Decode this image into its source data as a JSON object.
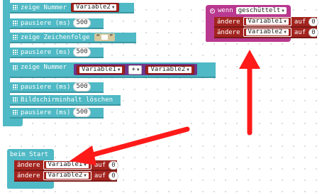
{
  "blocks": {
    "show_number_1": {
      "label": "zeige Nummer",
      "variable": "Variable2"
    },
    "pause_1": {
      "label": "pausiere (ms)",
      "value": "500"
    },
    "show_string": {
      "label": "zeige Zeichenfolge",
      "quote_open": "“",
      "quote_close": "”"
    },
    "pause_2": {
      "label": "pausiere (ms)",
      "value": "500"
    },
    "show_number_2": {
      "label": "zeige Nummer",
      "var_left": "Variable1",
      "operator": "+",
      "var_right": "Variable2"
    },
    "pause_3": {
      "label": "pausiere (ms)",
      "value": "500"
    },
    "clear_screen": {
      "label": "Bildschirminhalt löschen"
    },
    "pause_4": {
      "label": "pausiere (ms)",
      "value": "500"
    }
  },
  "on_shake": {
    "label": "wenn",
    "gesture": "geschüttelt",
    "rows": [
      {
        "label": "ändere",
        "variable": "Variable1",
        "connector": "auf",
        "value": "0"
      },
      {
        "label": "ändere",
        "variable": "Variable2",
        "connector": "auf",
        "value": "0"
      }
    ]
  },
  "on_start": {
    "label": "beim Start",
    "rows": [
      {
        "label": "ändere",
        "variable": "Variable1",
        "connector": "auf",
        "value": "0"
      },
      {
        "label": "ändere",
        "variable": "Variable2",
        "connector": "auf",
        "value": "0"
      }
    ]
  },
  "colors": {
    "basic": "#4fb9c5",
    "variables": "#a3241f",
    "input": "#b8398f",
    "math": "#70358a",
    "arrow": "#ff1a1a"
  }
}
